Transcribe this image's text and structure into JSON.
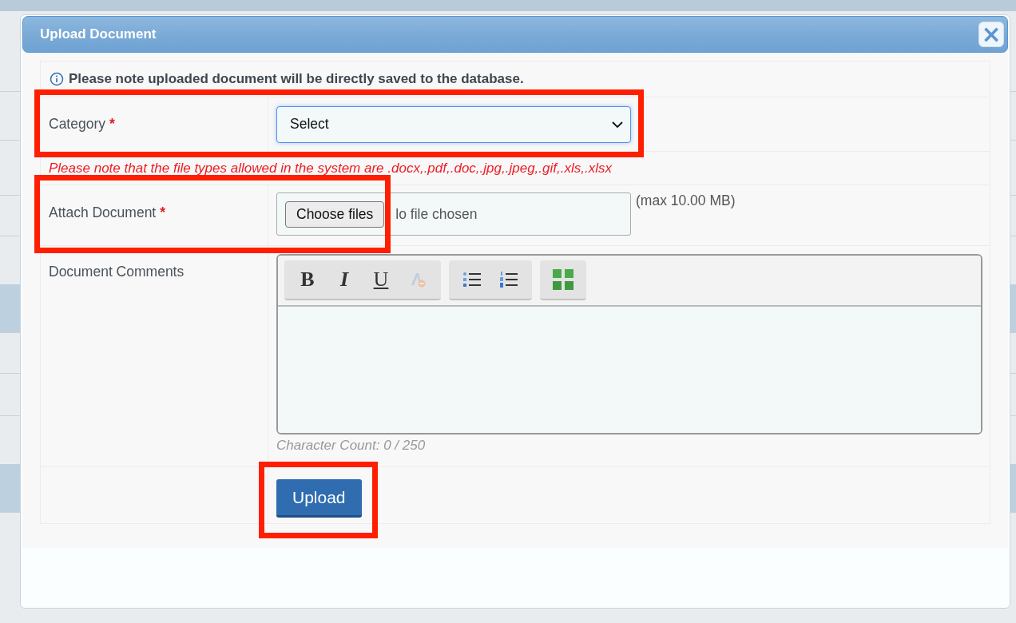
{
  "dialog": {
    "title": "Upload Document",
    "close_label": "×",
    "required_mark": "*",
    "notice": "Please note uploaded document will be directly saved to the database.",
    "fields": [
      {
        "kind": "select",
        "label": "Category",
        "required": true,
        "value": "Select",
        "focused": true,
        "highlighted": true
      },
      {
        "kind": "note",
        "text": "Please note that the file types allowed in the system are .docx,.pdf,.doc,.jpg,.jpeg,.gif,.xls,.xlsx"
      },
      {
        "kind": "file",
        "label": "Attach Document",
        "required": true,
        "button": "Choose files",
        "status_shown": "lo file chosen",
        "hint": "(max 10.00 MB)",
        "highlighted": true
      },
      {
        "kind": "editor",
        "label": "Document Comments",
        "required": false,
        "toolbar": [
          [
            {
              "kind": "bold",
              "glyph": "B",
              "disabled": false
            },
            {
              "kind": "italic",
              "glyph": "I",
              "disabled": false
            },
            {
              "kind": "underline",
              "glyph": "U",
              "disabled": false
            },
            {
              "kind": "remove-format",
              "disabled": true
            }
          ],
          [
            {
              "kind": "bullet-list",
              "disabled": false
            },
            {
              "kind": "numbered-list",
              "disabled": false
            }
          ],
          [
            {
              "kind": "fullscreen",
              "disabled": false
            }
          ]
        ],
        "counter": "Character Count: 0 / 250"
      },
      {
        "kind": "submit",
        "label": "Upload",
        "highlighted": true
      }
    ]
  }
}
